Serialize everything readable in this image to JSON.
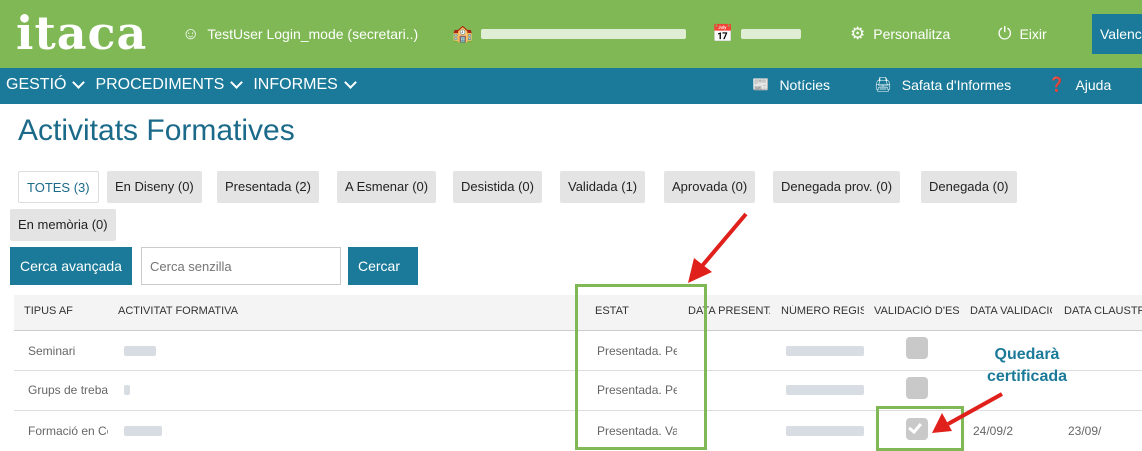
{
  "header": {
    "logo": "itaca",
    "user": "TestUser Login_mode (secretari..)",
    "personalize": "Personalitza",
    "exit": "Eixir",
    "language": "Valencià"
  },
  "nav": {
    "menus": [
      "GESTIÓ",
      "PROCEDIMENTS",
      "INFORMES"
    ],
    "news": "Notícies",
    "reports_tray": "Safata d'Informes",
    "help": "Ajuda"
  },
  "page_title": "Activitats Formatives",
  "tabs": [
    "TOTES (3)",
    "En Diseny (0)",
    "Presentada (2)",
    "A Esmenar (0)",
    "Desistida (0)",
    "Validada (1)",
    "Aprovada (0)",
    "Denegada prov. (0)",
    "Denegada (0)",
    "En memòria (0)"
  ],
  "search": {
    "advanced_button": "Cerca avançada",
    "simple_placeholder": "Cerca senzilla",
    "search_button": "Cercar"
  },
  "table": {
    "columns": [
      "TIPUS AF",
      "ACTIVITAT FORMATIVA",
      "ESTAT",
      "DATA PRESENTAC",
      "NÚMERO REGIST",
      "VALIDACIÓ D'ESP.",
      "DATA VALIDACIÓ",
      "DATA CLAUSTRE"
    ],
    "rows": [
      {
        "type": "Seminari",
        "status": "Presentada. Pe",
        "validated": false,
        "validation_date": "",
        "cloister_date": ""
      },
      {
        "type": "Grups de treba",
        "status": "Presentada. Pe",
        "validated": false,
        "validation_date": "",
        "cloister_date": ""
      },
      {
        "type": "Formació en Ce",
        "status": "Presentada. Va",
        "validated": true,
        "validation_date": "24/09/2",
        "cloister_date": "23/09/"
      }
    ]
  },
  "annotation": {
    "line1": "Quedarà",
    "line2": "certificada"
  },
  "colors": {
    "header_green": "#7fb855",
    "nav_blue": "#1b7a99",
    "annotation_red": "#e0201b",
    "annotation_text": "#1b7a99"
  }
}
